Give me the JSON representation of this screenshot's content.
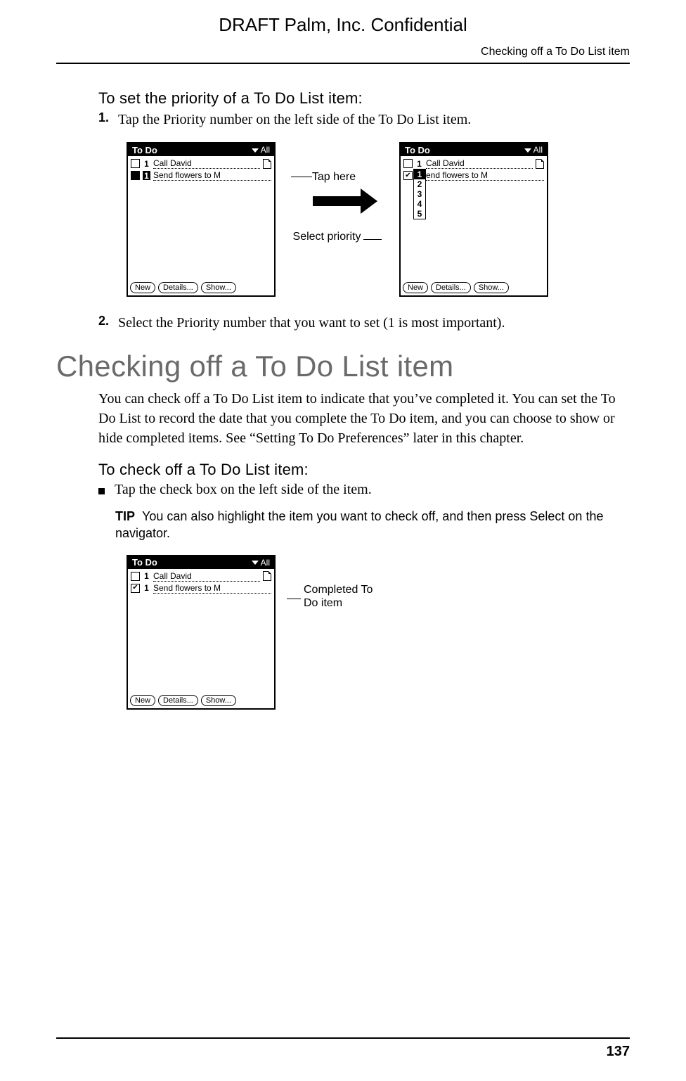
{
  "header": {
    "draft": "DRAFT   Palm, Inc. Confidential",
    "running": "Checking off a To Do List item"
  },
  "proc1": {
    "title": "To set the priority of a To Do List item:",
    "step1_num": "1.",
    "step1": "Tap the Priority number on the left side of the To Do List item.",
    "step2_num": "2.",
    "step2": "Select the Priority number that you want to set (1 is most important)."
  },
  "fig1": {
    "titlebar": "To Do",
    "category": "All",
    "task1_prio": "1",
    "task1": "Call David",
    "task2_prio": "1",
    "task2": "Send flowers to M",
    "task2b": "end flowers to M",
    "btn_new": "New",
    "btn_details": "Details...",
    "btn_show": "Show...",
    "callout_tap": "Tap here",
    "callout_select": "Select priority",
    "dd1": "1",
    "dd2": "2",
    "dd3": "3",
    "dd4": "4",
    "dd5": "5"
  },
  "section": {
    "heading": "Checking off a To Do List item",
    "para": "You can check off a To Do List item to indicate that you’ve completed it. You can set the To Do List to record the date that you complete the To Do item, and you can choose to show or hide completed items. See “Setting To Do Preferences” later in this chapter."
  },
  "proc2": {
    "title": "To check off a To Do List item:",
    "bullet": "Tap the check box on the left side of the item.",
    "tip_label": "TIP",
    "tip": "You can also highlight the item you want to check off, and then press Select on the navigator."
  },
  "fig2": {
    "callout": "Completed To Do item"
  },
  "footer": {
    "page": "137"
  }
}
